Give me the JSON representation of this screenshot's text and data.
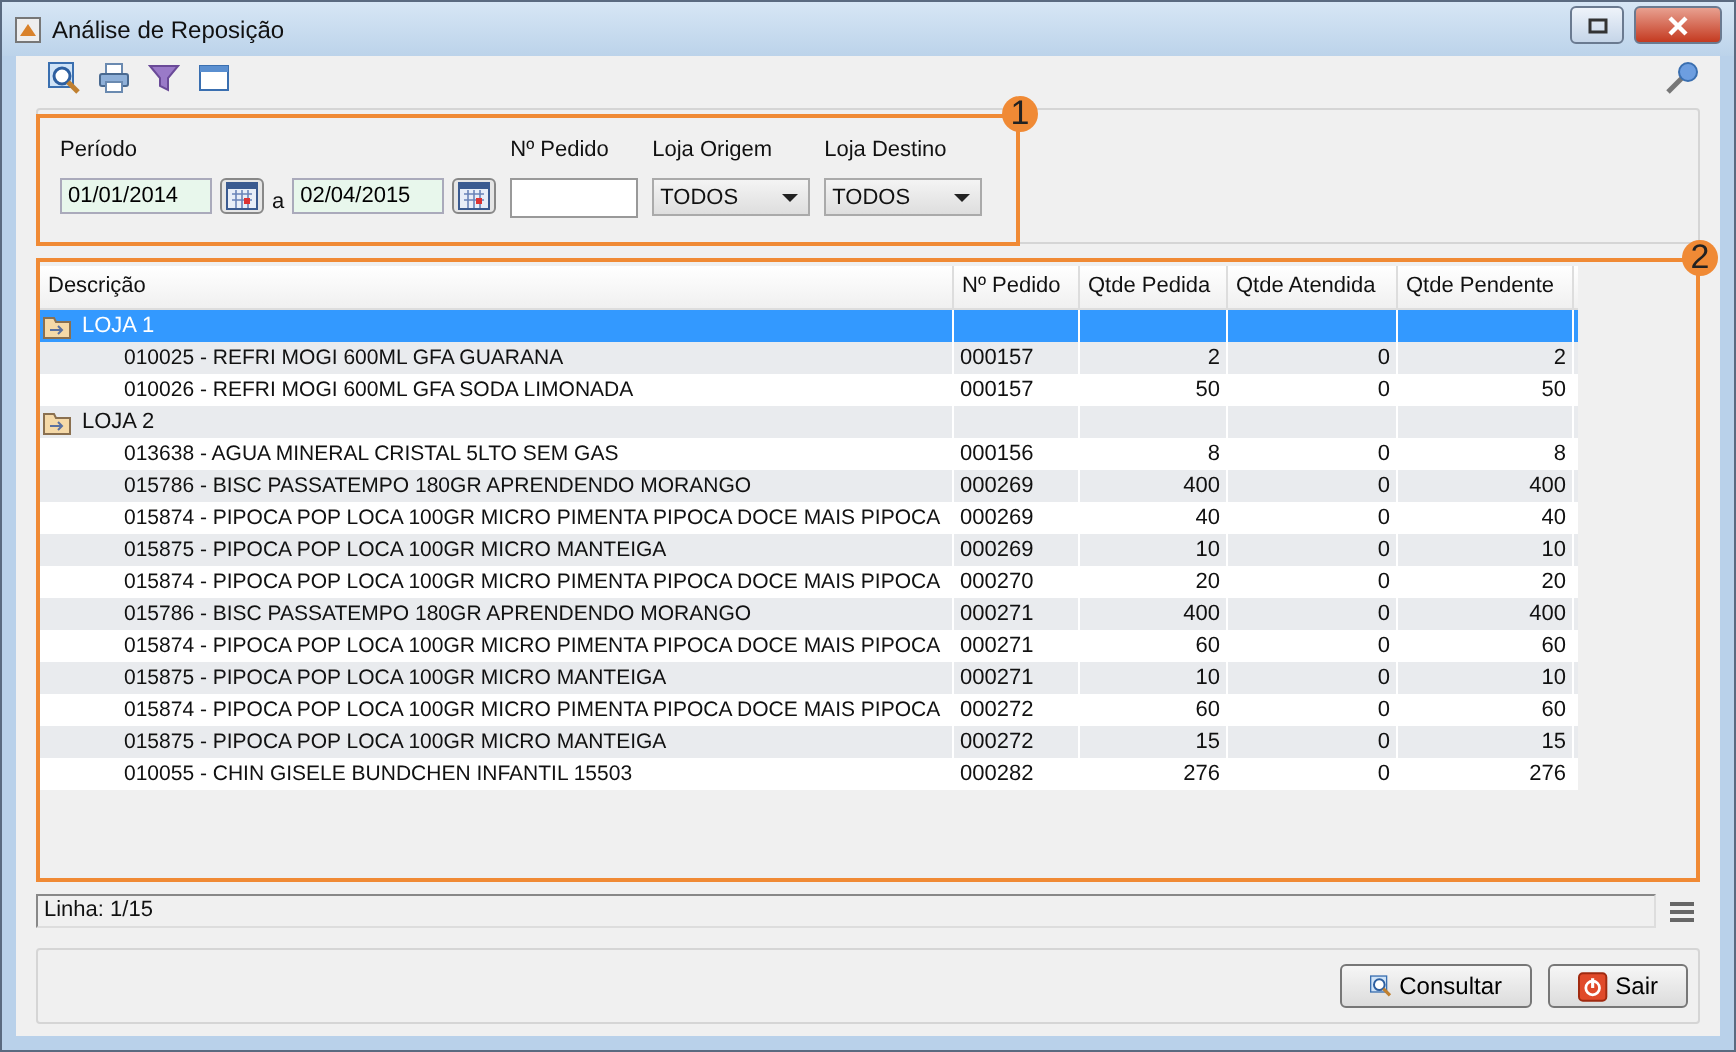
{
  "window": {
    "title": "Análise de Reposição"
  },
  "filter": {
    "period_label": "Período",
    "date_from": "01/01/2014",
    "range_word": "a",
    "date_to": "02/04/2015",
    "order_label": "Nº Pedido",
    "origin_label": "Loja Origem",
    "origin_value": "TODOS",
    "dest_label": "Loja Destino",
    "dest_value": "TODOS"
  },
  "callouts": [
    "1",
    "2"
  ],
  "table": {
    "columns": [
      "Descrição",
      "Nº Pedido",
      "Qtde Pedida",
      "Qtde Atendida",
      "Qtde Pendente"
    ],
    "rows": [
      {
        "kind": "group",
        "description": "LOJA 1",
        "selected": true
      },
      {
        "kind": "item",
        "description": "010025 - REFRI MOGI 600ML GFA GUARANA",
        "order": "000157",
        "requested": "2",
        "served": "0",
        "pending": "2",
        "selected": false
      },
      {
        "kind": "item",
        "description": "010026 - REFRI MOGI 600ML GFA SODA LIMONADA",
        "order": "000157",
        "requested": "50",
        "served": "0",
        "pending": "50",
        "selected": false
      },
      {
        "kind": "group",
        "description": "LOJA 2",
        "selected": false
      },
      {
        "kind": "item",
        "description": "013638 - AGUA MINERAL CRISTAL 5LTO SEM GAS",
        "order": "000156",
        "requested": "8",
        "served": "0",
        "pending": "8",
        "selected": false
      },
      {
        "kind": "item",
        "description": "015786 - BISC PASSATEMPO 180GR APRENDENDO MORANGO",
        "order": "000269",
        "requested": "400",
        "served": "0",
        "pending": "400",
        "selected": false
      },
      {
        "kind": "item",
        "description": "015874 - PIPOCA POP LOCA 100GR MICRO PIMENTA PIPOCA DOCE MAIS PIPOCA",
        "order": "000269",
        "requested": "40",
        "served": "0",
        "pending": "40",
        "selected": false
      },
      {
        "kind": "item",
        "description": "015875 - PIPOCA POP LOCA 100GR MICRO MANTEIGA",
        "order": "000269",
        "requested": "10",
        "served": "0",
        "pending": "10",
        "selected": false
      },
      {
        "kind": "item",
        "description": "015874 - PIPOCA POP LOCA 100GR MICRO PIMENTA PIPOCA DOCE MAIS PIPOCA",
        "order": "000270",
        "requested": "20",
        "served": "0",
        "pending": "20",
        "selected": false
      },
      {
        "kind": "item",
        "description": "015786 - BISC PASSATEMPO 180GR APRENDENDO MORANGO",
        "order": "000271",
        "requested": "400",
        "served": "0",
        "pending": "400",
        "selected": false
      },
      {
        "kind": "item",
        "description": "015874 - PIPOCA POP LOCA 100GR MICRO PIMENTA PIPOCA DOCE MAIS PIPOCA",
        "order": "000271",
        "requested": "60",
        "served": "0",
        "pending": "60",
        "selected": false
      },
      {
        "kind": "item",
        "description": "015875 - PIPOCA POP LOCA 100GR MICRO MANTEIGA",
        "order": "000271",
        "requested": "10",
        "served": "0",
        "pending": "10",
        "selected": false
      },
      {
        "kind": "item",
        "description": "015874 - PIPOCA POP LOCA 100GR MICRO PIMENTA PIPOCA DOCE MAIS PIPOCA",
        "order": "000272",
        "requested": "60",
        "served": "0",
        "pending": "60",
        "selected": false
      },
      {
        "kind": "item",
        "description": "015875 - PIPOCA POP LOCA 100GR MICRO MANTEIGA",
        "order": "000272",
        "requested": "15",
        "served": "0",
        "pending": "15",
        "selected": false
      },
      {
        "kind": "item",
        "description": "010055 - CHIN GISELE BUNDCHEN INFANTIL 15503",
        "order": "000282",
        "requested": "276",
        "served": "0",
        "pending": "276",
        "selected": false
      }
    ]
  },
  "status_bar": "Linha: 1/15",
  "buttons": [
    "Consultar",
    "Sair"
  ]
}
